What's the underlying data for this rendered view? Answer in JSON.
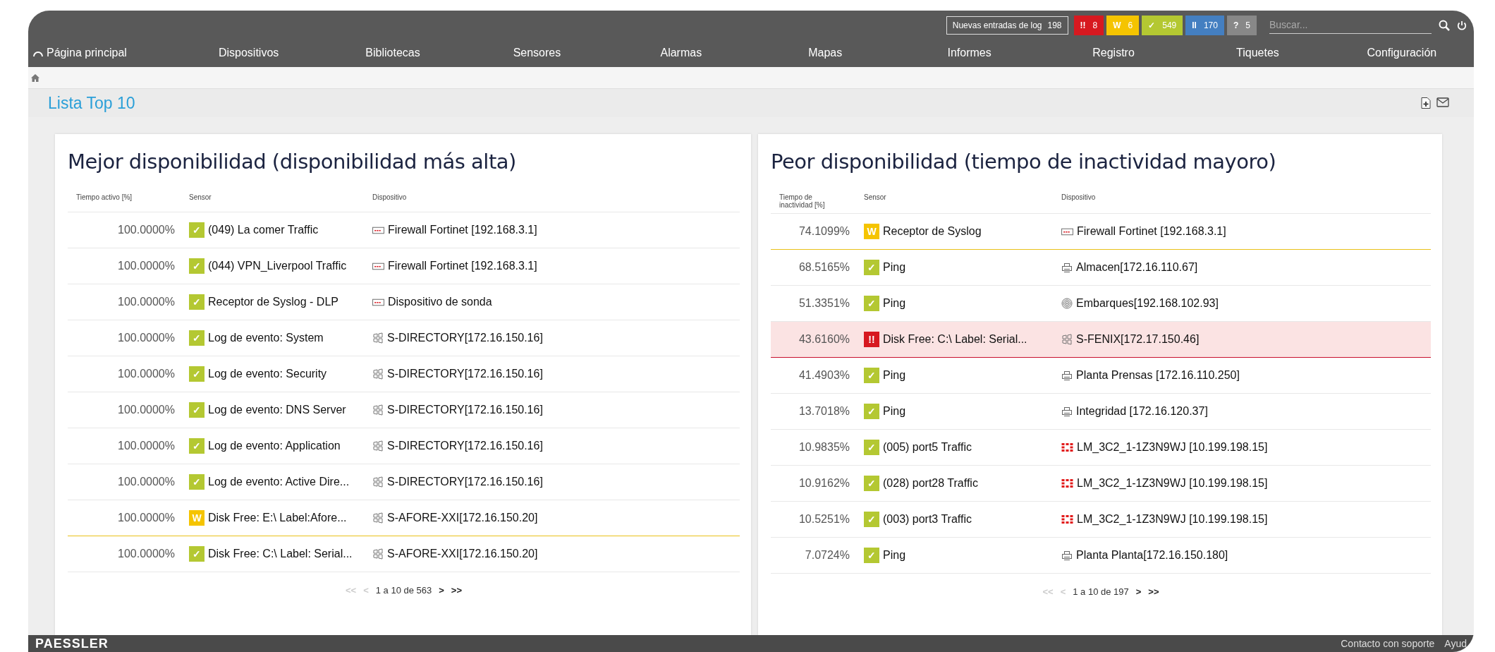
{
  "top_bar": {
    "log": {
      "label": "Nuevas entradas de log",
      "count": "198"
    },
    "status_badges": [
      {
        "kind": "error",
        "glyph": "!!",
        "count": "8"
      },
      {
        "kind": "warning",
        "glyph": "W",
        "count": "6"
      },
      {
        "kind": "ok",
        "glyph": "✓",
        "count": "549"
      },
      {
        "kind": "paused",
        "glyph": "II",
        "count": "170"
      },
      {
        "kind": "unknown",
        "glyph": "?",
        "count": "5"
      }
    ],
    "search": {
      "placeholder": "Buscar..."
    }
  },
  "nav": [
    {
      "label": "Página principal",
      "kind": "home"
    },
    {
      "label": "Dispositivos"
    },
    {
      "label": "Bibliotecas"
    },
    {
      "label": "Sensores"
    },
    {
      "label": "Alarmas"
    },
    {
      "label": "Mapas"
    },
    {
      "label": "Informes"
    },
    {
      "label": "Registro"
    },
    {
      "label": "Tiquetes"
    },
    {
      "label": "Configuración"
    }
  ],
  "page_title": "Lista Top 10",
  "panels": [
    {
      "title": "Mejor disponibilidad (disponibilidad más alta)",
      "columns": [
        "Tiempo activo [%]",
        "Sensor",
        "Dispositivo"
      ],
      "rows": [
        {
          "value": "100.0000%",
          "kind": "ok",
          "glyph": "✓",
          "sensor": "(049) La comer Traffic",
          "device": {
            "kind": "probe",
            "label": "Firewall Fortinet [192.168.3.1]"
          }
        },
        {
          "value": "100.0000%",
          "kind": "ok",
          "glyph": "✓",
          "sensor": "(044) VPN_Liverpool Traffic",
          "device": {
            "kind": "probe",
            "label": "Firewall Fortinet [192.168.3.1]"
          }
        },
        {
          "value": "100.0000%",
          "kind": "ok",
          "glyph": "✓",
          "sensor": "Receptor de Syslog - DLP",
          "device": {
            "kind": "probe",
            "label": "Dispositivo de sonda"
          }
        },
        {
          "value": "100.0000%",
          "kind": "ok",
          "glyph": "✓",
          "sensor": "Log de evento: System",
          "device": {
            "kind": "windows",
            "label": "S-DIRECTORY[172.16.150.16]"
          }
        },
        {
          "value": "100.0000%",
          "kind": "ok",
          "glyph": "✓",
          "sensor": "Log de evento: Security",
          "device": {
            "kind": "windows",
            "label": "S-DIRECTORY[172.16.150.16]"
          }
        },
        {
          "value": "100.0000%",
          "kind": "ok",
          "glyph": "✓",
          "sensor": "Log de evento: DNS Server",
          "device": {
            "kind": "windows",
            "label": "S-DIRECTORY[172.16.150.16]"
          }
        },
        {
          "value": "100.0000%",
          "kind": "ok",
          "glyph": "✓",
          "sensor": "Log de evento: Application",
          "device": {
            "kind": "windows",
            "label": "S-DIRECTORY[172.16.150.16]"
          }
        },
        {
          "value": "100.0000%",
          "kind": "ok",
          "glyph": "✓",
          "sensor": "Log de evento: Active Dire...",
          "device": {
            "kind": "windows",
            "label": "S-DIRECTORY[172.16.150.16]"
          }
        },
        {
          "value": "100.0000%",
          "kind": "warning",
          "glyph": "W",
          "sensor": "Disk Free: E:\\ Label:Afore...",
          "device": {
            "kind": "windows",
            "label": "S-AFORE-XXI[172.16.150.20]"
          }
        },
        {
          "value": "100.0000%",
          "kind": "ok",
          "glyph": "✓",
          "sensor": "Disk Free: C:\\ Label: Serial...",
          "device": {
            "kind": "windows",
            "label": "S-AFORE-XXI[172.16.150.20]"
          }
        }
      ],
      "pagination": [
        {
          "label": "<<",
          "disabled": true
        },
        {
          "label": "<",
          "disabled": true
        },
        {
          "label": "1 a 10 de 563",
          "kind": "range"
        },
        {
          "label": ">",
          "disabled": false
        },
        {
          "label": ">>",
          "disabled": false
        }
      ]
    },
    {
      "title": "Peor disponibilidad (tiempo de inactividad mayoro)",
      "columns": [
        "Tiempo de inactividad [%]",
        "Sensor",
        "Dispositivo"
      ],
      "rows": [
        {
          "value": "74.1099%",
          "kind": "warning",
          "glyph": "W",
          "sensor": "Receptor de Syslog",
          "device": {
            "kind": "probe",
            "label": "Firewall Fortinet [192.168.3.1]"
          }
        },
        {
          "value": "68.5165%",
          "kind": "ok",
          "glyph": "✓",
          "sensor": "Ping",
          "device": {
            "kind": "printer",
            "label": "Almacen[172.16.110.67]"
          }
        },
        {
          "value": "51.3351%",
          "kind": "ok",
          "glyph": "✓",
          "sensor": "Ping",
          "device": {
            "kind": "fingerprint",
            "label": "Embarques[192.168.102.93]"
          }
        },
        {
          "value": "43.6160%",
          "kind": "error",
          "glyph": "!!",
          "sensor": "Disk Free: C:\\ Label: Serial...",
          "device": {
            "kind": "windows",
            "label": "S-FENIX[172.17.150.46]"
          }
        },
        {
          "value": "41.4903%",
          "kind": "ok",
          "glyph": "✓",
          "sensor": "Ping",
          "device": {
            "kind": "printer",
            "label": "Planta Prensas [172.16.110.250]"
          }
        },
        {
          "value": "13.7018%",
          "kind": "ok",
          "glyph": "✓",
          "sensor": "Ping",
          "device": {
            "kind": "printer",
            "label": "Integridad [172.16.120.37]"
          }
        },
        {
          "value": "10.9835%",
          "kind": "ok",
          "glyph": "✓",
          "sensor": "(005) port5 Traffic",
          "device": {
            "kind": "fortinet",
            "label": "LM_3C2_1-1Z3N9WJ [10.199.198.15]"
          }
        },
        {
          "value": "10.9162%",
          "kind": "ok",
          "glyph": "✓",
          "sensor": "(028) port28 Traffic",
          "device": {
            "kind": "fortinet",
            "label": "LM_3C2_1-1Z3N9WJ [10.199.198.15]"
          }
        },
        {
          "value": "10.5251%",
          "kind": "ok",
          "glyph": "✓",
          "sensor": "(003) port3 Traffic",
          "device": {
            "kind": "fortinet",
            "label": "LM_3C2_1-1Z3N9WJ [10.199.198.15]"
          }
        },
        {
          "value": "7.0724%",
          "kind": "ok",
          "glyph": "✓",
          "sensor": "Ping",
          "device": {
            "kind": "printer",
            "label": "Planta Planta[172.16.150.180]"
          }
        }
      ],
      "pagination": [
        {
          "label": "<<",
          "disabled": true
        },
        {
          "label": "<",
          "disabled": true
        },
        {
          "label": "1 a 10 de 197",
          "kind": "range"
        },
        {
          "label": ">",
          "disabled": false
        },
        {
          "label": ">>",
          "disabled": false
        }
      ]
    }
  ],
  "footer": {
    "brand": "PAESSLER",
    "links": [
      "Contacto con soporte",
      "Ayud"
    ]
  }
}
